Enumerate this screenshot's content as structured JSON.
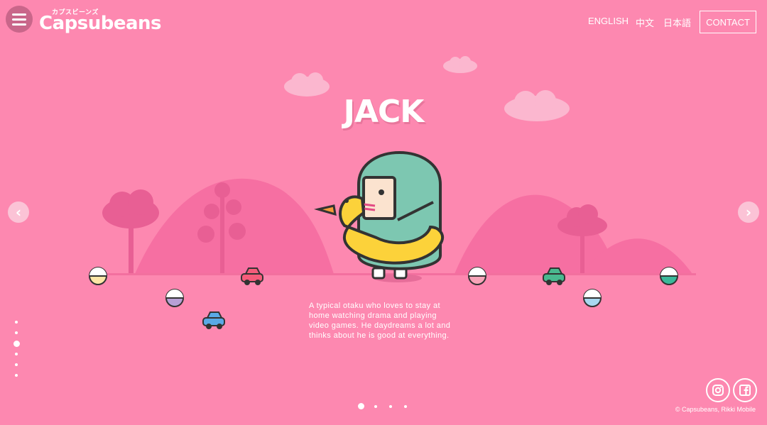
{
  "header": {
    "menu_icon": "hamburger-menu-icon",
    "logo_kana": "カプスビーンズ",
    "logo_text": "Capsubeans",
    "nav": [
      {
        "label": "ENGLISH"
      },
      {
        "label": "中文"
      },
      {
        "label": "日本語"
      }
    ],
    "contact_label": "CONTACT"
  },
  "character": {
    "name": "JACK",
    "description": "A typical otaku who loves to stay at home watching drama and playing video games. He daydreams a lot and thinks about he is good at everything."
  },
  "carousel": {
    "prev_icon": "chevron-left-icon",
    "next_icon": "chevron-right-icon",
    "vertical_dots": {
      "count": 6,
      "active": 2
    },
    "horizontal_dots": {
      "count": 4,
      "active": 0
    }
  },
  "footer": {
    "instagram_icon": "instagram-icon",
    "facebook_icon": "facebook-icon",
    "copyright": "© Capsubeans, Rikki Mobile"
  },
  "colors": {
    "background": "#fd88b0",
    "hills": "#f66fa2",
    "character_body": "#7dc7b1",
    "duck_ring": "#fcd23a"
  }
}
